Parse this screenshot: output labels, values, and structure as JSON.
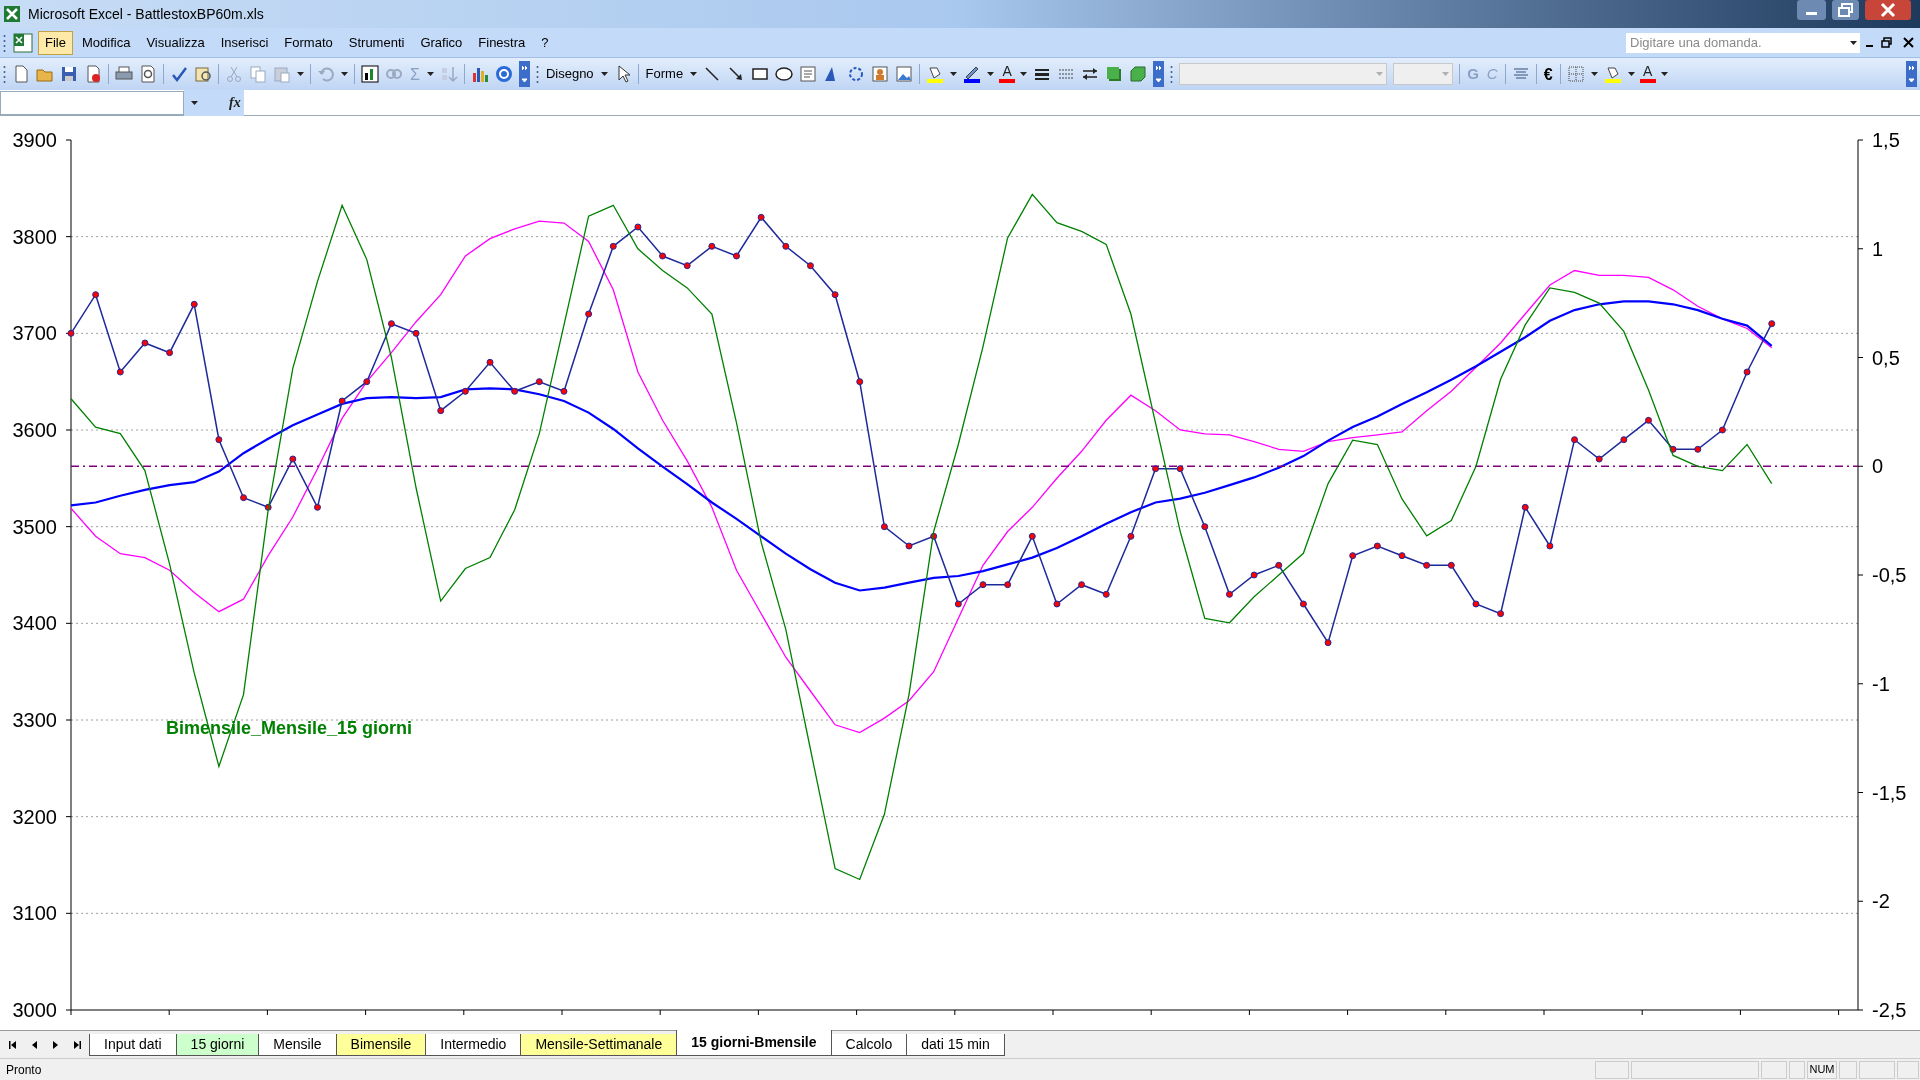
{
  "window": {
    "title": "Microsoft Excel - BattlestoxBP60m.xls"
  },
  "menu": [
    {
      "label": "File",
      "selected": true
    },
    {
      "label": "Modifica",
      "selected": false
    },
    {
      "label": "Visualizza",
      "selected": false
    },
    {
      "label": "Inserisci",
      "selected": false
    },
    {
      "label": "Formato",
      "selected": false
    },
    {
      "label": "Strumenti",
      "selected": false
    },
    {
      "label": "Grafico",
      "selected": false
    },
    {
      "label": "Finestra",
      "selected": false
    },
    {
      "label": "?",
      "selected": false
    }
  ],
  "help_search": {
    "placeholder": "Digitare una domanda."
  },
  "toolbar": {
    "sum_button": {
      "label": "Σ",
      "disabled": true
    },
    "drawing_menu": "Disegno",
    "shapes_menu": "Forme",
    "bold_button": {
      "label": "G",
      "disabled": true
    },
    "italic_button": {
      "label": "C",
      "disabled": true
    },
    "euro_button": "€",
    "font_color_buttons": [
      "A",
      "A"
    ]
  },
  "formula_bar": {
    "function_button": "fx"
  },
  "chart": {
    "chart_data": {
      "type": "line",
      "grid": true,
      "title": "Bimensile_Mensile_15 giorni",
      "ylim": [
        3000,
        3900
      ],
      "yticks": [
        3000,
        3100,
        3200,
        3300,
        3400,
        3500,
        3600,
        3700,
        3800,
        3900
      ],
      "categories": [
        null,
        null,
        null,
        null,
        null,
        null,
        null,
        null,
        null,
        null,
        null,
        null,
        null,
        null,
        null,
        null,
        null,
        null,
        null,
        null,
        null,
        null,
        null,
        null,
        null,
        null,
        null,
        null,
        null,
        null,
        null,
        null,
        null,
        null,
        null,
        null,
        null,
        null,
        null,
        null,
        null,
        null,
        null,
        null,
        null,
        null,
        null,
        null,
        null,
        null,
        null,
        null,
        null,
        null,
        null,
        null,
        null,
        null,
        null,
        null,
        null,
        null,
        null,
        null,
        null,
        null,
        null,
        null,
        null,
        null
      ],
      "series": [
        {
          "color": "#ff00ff",
          "values": [
            3519,
            3490,
            3472,
            3468,
            3455,
            3432,
            3412,
            3425,
            3470,
            3510,
            3560,
            3612,
            3650,
            3680,
            3712,
            3740,
            3780,
            3798,
            3808,
            3816,
            3814,
            3795,
            3745,
            3660,
            3610,
            3568,
            3520,
            3455,
            3410,
            3365,
            3330,
            3295,
            3287,
            3302,
            3320,
            3350,
            3405,
            3460,
            3495,
            3520,
            3550,
            3578,
            3610,
            3636,
            3620,
            3600,
            3596,
            3595,
            3588,
            3580,
            3578,
            3588,
            3592,
            3595,
            3598,
            3620,
            3640,
            3665,
            3690,
            3720,
            3750,
            3765,
            3760,
            3760,
            3758,
            3745,
            3728,
            3715,
            3705,
            3685
          ]
        },
        {
          "color": "#0000ff",
          "values": [
            3522,
            3525,
            3532,
            3538,
            3543,
            3546,
            3557,
            3576,
            3591,
            3605,
            3616,
            3627,
            3633,
            3634,
            3633,
            3634,
            3642,
            3643,
            3642,
            3637,
            3630,
            3618,
            3601,
            3581,
            3562,
            3544,
            3525,
            3508,
            3490,
            3472,
            3456,
            3442,
            3434,
            3437,
            3442,
            3447,
            3449,
            3454,
            3461,
            3468,
            3478,
            3490,
            3503,
            3515,
            3525,
            3529,
            3535,
            3543,
            3551,
            3561,
            3573,
            3589,
            3603,
            3614,
            3627,
            3639,
            3652,
            3666,
            3681,
            3696,
            3713,
            3724,
            3730,
            3733,
            3733,
            3730,
            3724,
            3715,
            3708,
            3687
          ]
        },
        {
          "color": "#1f2a9a",
          "marker": "circle",
          "values": [
            3700,
            3740,
            3660,
            3690,
            3680,
            3730,
            3590,
            3530,
            3520,
            3570,
            3520,
            3630,
            3650,
            3710,
            3700,
            3620,
            3640,
            3670,
            3640,
            3650,
            3640,
            3720,
            3790,
            3810,
            3780,
            3770,
            3790,
            3780,
            3820,
            3790,
            3770,
            3740,
            3650,
            3500,
            3480,
            3490,
            3420,
            3440,
            3440,
            3490,
            3420,
            3440,
            3430,
            3490,
            3560,
            3560,
            3500,
            3430,
            3450,
            3460,
            3420,
            3380,
            3470,
            3480,
            3470,
            3460,
            3460,
            3420,
            3410,
            3520,
            3480,
            3590,
            3570,
            3590,
            3610,
            3580,
            3580,
            3600,
            3660,
            3710
          ]
        }
      ]
    }
  },
  "chart_overlay": {
    "chart_data": {
      "type": "line",
      "ylim": [
        -2.5,
        1.5
      ],
      "yticks": [
        {
          "value": -2.5,
          "label": "-2,5"
        },
        {
          "value": -2,
          "label": "-2"
        },
        {
          "value": -1.5,
          "label": "-1,5"
        },
        {
          "value": -1,
          "label": "-1"
        },
        {
          "value": -0.5,
          "label": "-0,5"
        },
        {
          "value": 0,
          "label": "0"
        },
        {
          "value": 0.5,
          "label": "0,5"
        },
        {
          "value": 1,
          "label": "1"
        },
        {
          "value": 1.5,
          "label": "1,5"
        }
      ],
      "categories": [
        null,
        null,
        null,
        null,
        null,
        null,
        null,
        null,
        null,
        null,
        null,
        null,
        null,
        null,
        null,
        null,
        null,
        null,
        null,
        null,
        null,
        null,
        null,
        null,
        null,
        null,
        null,
        null,
        null,
        null,
        null,
        null,
        null,
        null,
        null,
        null,
        null,
        null,
        null,
        null,
        null,
        null,
        null,
        null,
        null,
        null,
        null,
        null,
        null,
        null,
        null,
        null,
        null,
        null,
        null,
        null,
        null,
        null,
        null,
        null,
        null,
        null,
        null,
        null,
        null,
        null,
        null,
        null,
        null,
        null
      ],
      "series": [
        {
          "color": "#008000",
          "values": [
            0.31,
            0.18,
            0.15,
            -0.02,
            -0.45,
            -0.95,
            -1.38,
            -1.05,
            -0.2,
            0.45,
            0.85,
            1.2,
            0.95,
            0.5,
            -0.1,
            -0.62,
            -0.47,
            -0.42,
            -0.2,
            0.15,
            0.65,
            1.15,
            1.2,
            1.0,
            0.9,
            0.82,
            0.7,
            0.2,
            -0.35,
            -0.75,
            -1.3,
            -1.85,
            -1.9,
            -1.6,
            -1.05,
            -0.3,
            0.1,
            0.55,
            1.05,
            1.25,
            1.12,
            1.08,
            1.02,
            0.7,
            0.2,
            -0.3,
            -0.7,
            -0.72,
            -0.6,
            -0.5,
            -0.4,
            -0.08,
            0.12,
            0.1,
            -0.15,
            -0.32,
            -0.25,
            0.0,
            0.4,
            0.65,
            0.82,
            0.8,
            0.75,
            0.62,
            0.35,
            0.05,
            0.0,
            -0.02,
            0.1,
            -0.08
          ]
        }
      ],
      "ref_lines": [
        {
          "axis": "y",
          "value": 0,
          "color": "#800080"
        }
      ]
    }
  },
  "sheet_tabs": [
    {
      "label": "Input dati",
      "selected": false,
      "color": "#ffffff"
    },
    {
      "label": "15 giorni",
      "selected": false,
      "color": "#ccffcc"
    },
    {
      "label": "Mensile",
      "selected": false,
      "color": "#ffffff"
    },
    {
      "label": "Bimensile",
      "selected": false,
      "color": "#ffff99"
    },
    {
      "label": "Intermedio",
      "selected": false,
      "color": "#ffffff"
    },
    {
      "label": "Mensile-Settimanale",
      "selected": false,
      "color": "#ffff99"
    },
    {
      "label": "15 giorni-Bmensile",
      "selected": true,
      "color": "#ffffff"
    },
    {
      "label": "Calcolo",
      "selected": false,
      "color": "#ffffff"
    },
    {
      "label": "dati 15 min",
      "selected": false,
      "color": "#ffffff"
    }
  ],
  "status_bar": {
    "mode": "Pronto",
    "indicators": [
      "NUM"
    ]
  }
}
